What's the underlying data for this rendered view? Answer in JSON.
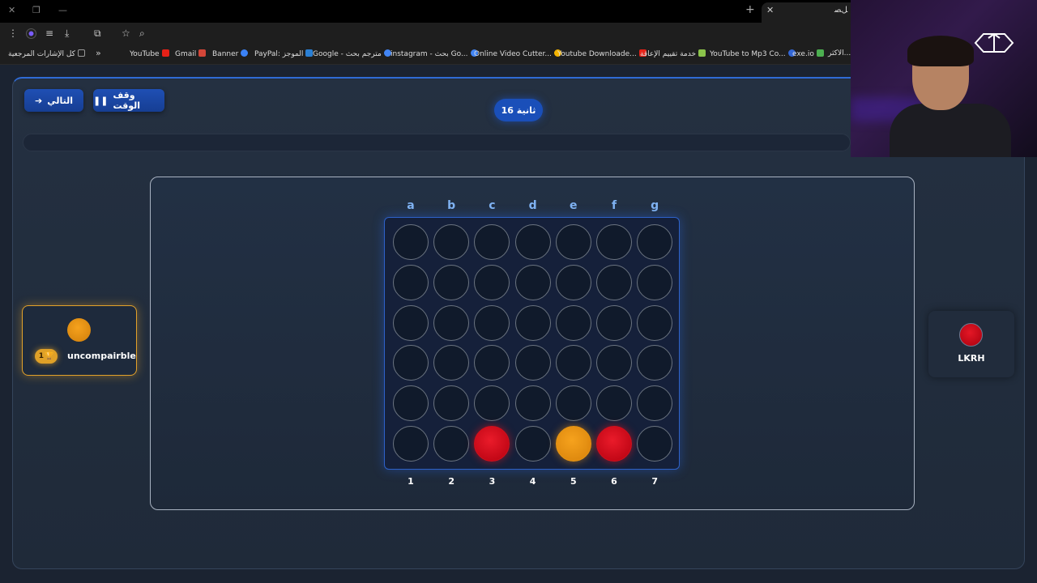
{
  "browser": {
    "tab_title": "ﻞﺼ",
    "bookmarks": [
      {
        "label": "كل الإشارات المرجعية",
        "color": "#777"
      },
      {
        "label": "YouTube",
        "color": "#e62117"
      },
      {
        "label": "Gmail",
        "color": "#d44638"
      },
      {
        "label": "Banner",
        "color": "#3b82f6"
      },
      {
        "label": "PayPal: الموجز",
        "color": "#2a7fd4"
      },
      {
        "label": "Google - مترجم بحث",
        "color": "#4285f4"
      },
      {
        "label": "instagram - بحث Go...",
        "color": "#4285f4"
      },
      {
        "label": "Online Video Cutter...",
        "color": "#f4b400"
      },
      {
        "label": "Youtube Downloade...",
        "color": "#e62117"
      },
      {
        "label": "خدمة تقييم الإعاقة",
        "color": "#8bc34a"
      },
      {
        "label": "YouTube to Mp3 Co...",
        "color": "#3367d6"
      },
      {
        "label": "exe.io",
        "color": "#4caf50"
      },
      {
        "label": "الاكثر...",
        "color": "#888"
      }
    ]
  },
  "controls": {
    "next_label": "التالي",
    "pause_label": "وقف الوقت",
    "timer": "16 ثانية"
  },
  "board": {
    "columns": [
      "a",
      "b",
      "c",
      "d",
      "e",
      "f",
      "g"
    ],
    "numbers": [
      "1",
      "2",
      "3",
      "4",
      "5",
      "6",
      "7"
    ],
    "rows": 6,
    "bottom_row": [
      "empty",
      "empty",
      "red",
      "empty",
      "orange",
      "red",
      "empty"
    ],
    "colors": {
      "red": "#e41726",
      "orange": "#f2a01a"
    }
  },
  "players": {
    "left": {
      "name": "uncompairble",
      "score": "1",
      "disc": "orange"
    },
    "right": {
      "name": "LKRH",
      "disc": "red"
    }
  }
}
